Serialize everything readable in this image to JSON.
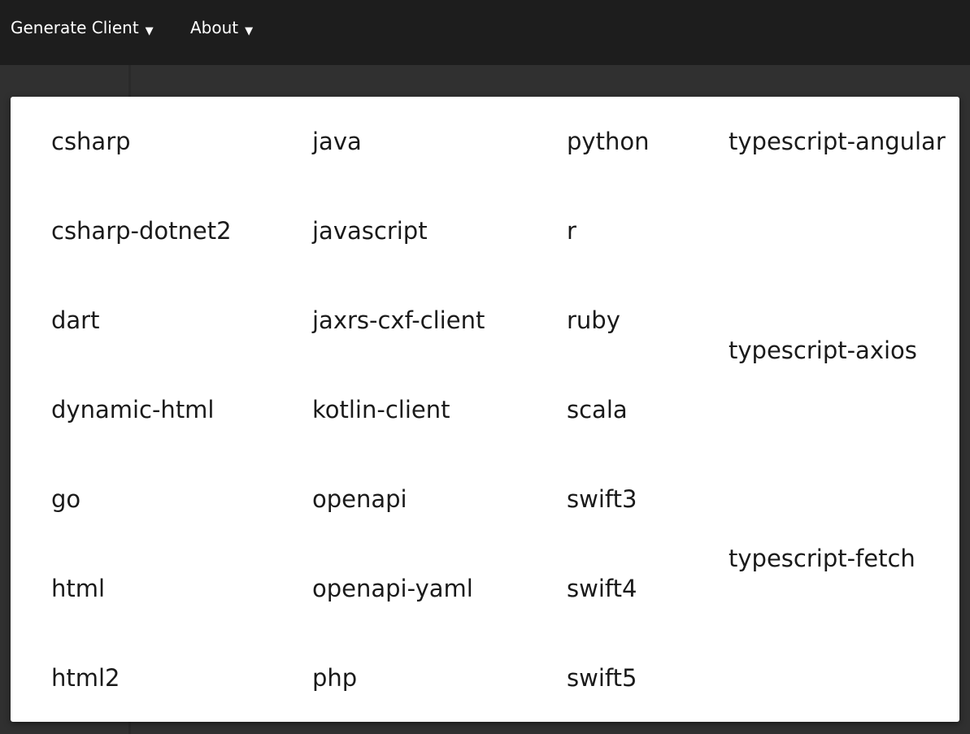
{
  "nav": {
    "generate_client": "Generate Client",
    "about": "About",
    "arrow": "▼"
  },
  "dropdown": {
    "columns": [
      [
        "csharp",
        "csharp-dotnet2",
        "dart",
        "dynamic-html",
        "go",
        "html",
        "html2"
      ],
      [
        "java",
        "javascript",
        "jaxrs-cxf-client",
        "kotlin-client",
        "openapi",
        "openapi-yaml",
        "php"
      ],
      [
        "python",
        "r",
        "ruby",
        "scala",
        "swift3",
        "swift4",
        "swift5"
      ],
      [
        "typescript-angular",
        "typescript-axios",
        "typescript-fetch"
      ]
    ]
  }
}
